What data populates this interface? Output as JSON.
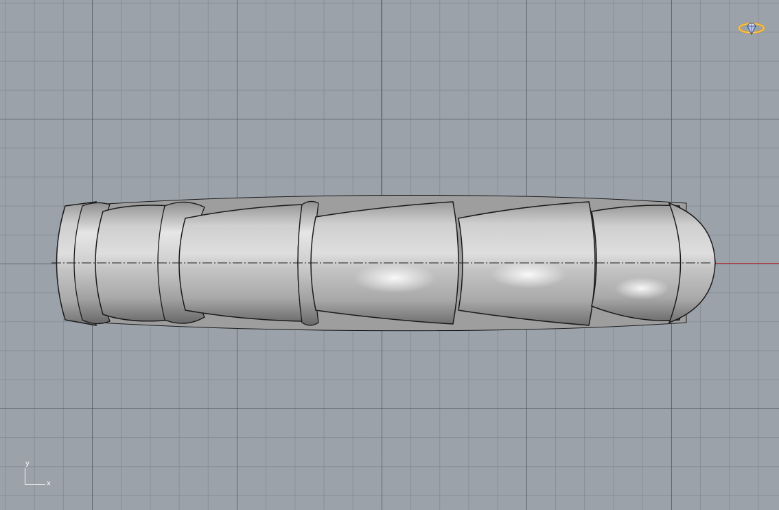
{
  "viewport": {
    "view": "Top",
    "background": "#9ba2aa",
    "colors": {
      "x_axis": "#d23838",
      "y_axis": "#2fa84f",
      "grid_major": "#40464e",
      "grid_minor": "#787e86",
      "model_shade": "#b9b9b9",
      "gem_icon": "#e8a21c"
    }
  },
  "corner_axes": {
    "y_label": "y",
    "x_label": "x"
  },
  "icons": {
    "gem": "ring-gem-icon"
  }
}
